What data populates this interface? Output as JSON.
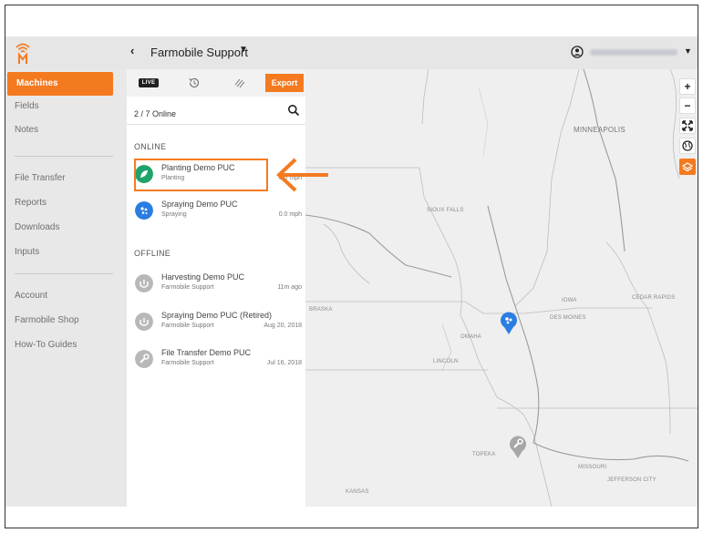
{
  "header": {
    "org_name": "Farmobile Support",
    "back_icon": "chevron-left-icon",
    "user_icon": "user-circle-icon"
  },
  "sidebar": {
    "items": [
      {
        "label": "Machines",
        "active": true
      },
      {
        "label": "Fields"
      },
      {
        "label": "Notes"
      },
      {
        "label": "File Transfer"
      },
      {
        "label": "Reports"
      },
      {
        "label": "Downloads"
      },
      {
        "label": "Inputs"
      },
      {
        "label": "Account"
      },
      {
        "label": "Farmobile Shop"
      },
      {
        "label": "How-To Guides"
      }
    ]
  },
  "panel": {
    "tabs": {
      "live_label": "LIVE",
      "history_icon": "history-icon",
      "stripes_icon": "hatch-icon"
    },
    "export_label": "Export",
    "online_count": "2 / 7 Online",
    "online_label": "ONLINE",
    "offline_label": "OFFLINE",
    "online_machines": [
      {
        "name": "Planting Demo PUC",
        "sub": "Planting",
        "meta": "6.0 mph",
        "color": "#1fa36a",
        "icon": "leaf-icon"
      },
      {
        "name": "Spraying Demo PUC",
        "sub": "Spraying",
        "meta": "0.0 mph",
        "color": "#2a7de1",
        "icon": "spray-icon"
      }
    ],
    "offline_machines": [
      {
        "name": "Harvesting Demo PUC",
        "sub": "Farmobile Support",
        "meta": "11m ago",
        "color": "#b8b8b8",
        "icon": "harvest-icon"
      },
      {
        "name": "Spraying Demo PUC (Retired)",
        "sub": "Farmobile Support",
        "meta": "Aug 20, 2018",
        "color": "#b8b8b8",
        "icon": "harvest-icon"
      },
      {
        "name": "File Transfer Demo PUC",
        "sub": "Farmobile Support",
        "meta": "Jul 16, 2018",
        "color": "#b8b8b8",
        "icon": "wrench-icon"
      }
    ]
  },
  "map": {
    "cities": {
      "minneapolis": "MINNEAPOLIS",
      "sioux_falls": "SIOUX FALLS",
      "iowa": "IOWA",
      "cedar_rapids": "CEDAR RAPIDS",
      "des_moines": "DES MOINES",
      "omaha": "OMAHA",
      "lincoln": "LINCOLN",
      "braska": "BRASKA",
      "topeka": "TOPEKA",
      "missouri": "MISSOURI",
      "jefferson_city": "JEFFERSON CITY",
      "kansas": "KANSAS"
    },
    "controls": [
      "+",
      "−"
    ]
  },
  "colors": {
    "accent": "#f47a20",
    "sidebar_bg": "#e8e8e8",
    "map_bg": "#efefef"
  }
}
